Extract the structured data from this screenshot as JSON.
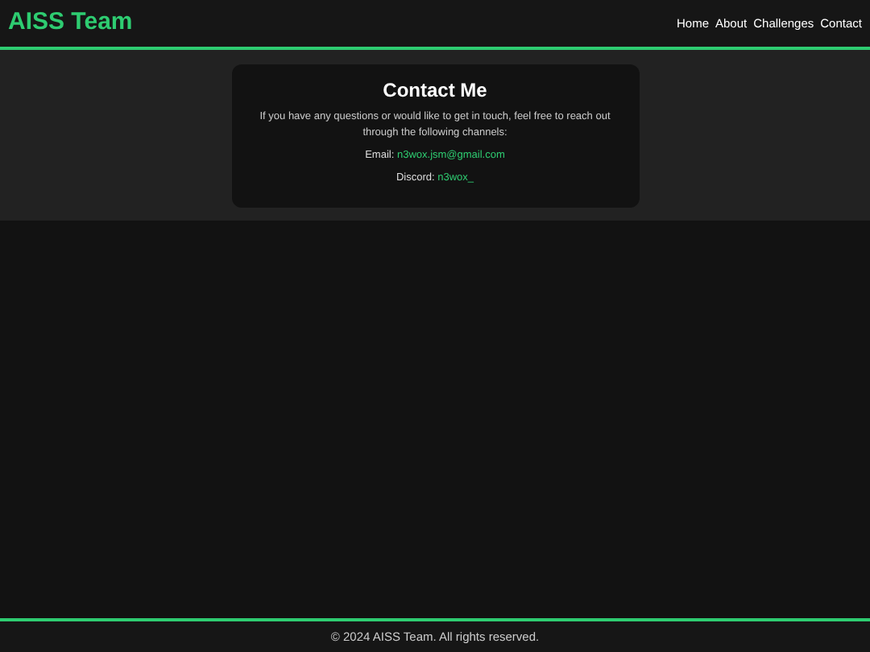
{
  "header": {
    "logo": "AISS Team",
    "nav": [
      "Home",
      "About",
      "Challenges",
      "Contact"
    ]
  },
  "contact": {
    "title": "Contact Me",
    "intro": "If you have any questions or would like to get in touch, feel free to reach out through the following channels:",
    "channels": [
      {
        "label": "Email:",
        "value": "n3wox.jsm@gmail.com"
      },
      {
        "label": "Discord:",
        "value": "n3wox_"
      }
    ]
  },
  "footer": {
    "text": "© 2024 AISS Team. All rights reserved."
  }
}
